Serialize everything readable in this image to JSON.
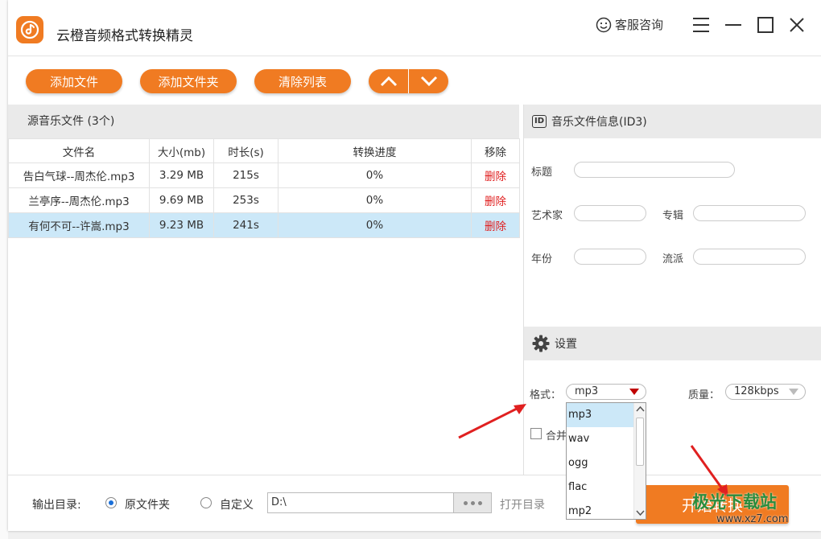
{
  "app": {
    "title": "云橙音频格式转换精灵",
    "customer_service": "客服咨询"
  },
  "toolbar": {
    "add_file": "添加文件",
    "add_folder": "添加文件夹",
    "clear_list": "清除列表"
  },
  "file_list": {
    "header": "源音乐文件 (3个)",
    "columns": [
      "文件名",
      "大小(mb)",
      "时长(s)",
      "转换进度",
      "移除"
    ],
    "rows": [
      {
        "name": "告白气球--周杰伦.mp3",
        "size": "3.29 MB",
        "duration": "215s",
        "progress": "0%",
        "remove": "删除",
        "selected": false
      },
      {
        "name": "兰亭序--周杰伦.mp3",
        "size": "9.69 MB",
        "duration": "253s",
        "progress": "0%",
        "remove": "删除",
        "selected": false
      },
      {
        "name": "有何不可--许嵩.mp3",
        "size": "9.23 MB",
        "duration": "241s",
        "progress": "0%",
        "remove": "删除",
        "selected": true
      }
    ]
  },
  "id3": {
    "header": "音乐文件信息(ID3)",
    "badge": "ID",
    "title_label": "标题",
    "artist_label": "艺术家",
    "album_label": "专辑",
    "year_label": "年份",
    "genre_label": "流派",
    "title_value": "",
    "artist_value": "",
    "album_value": "",
    "year_value": "",
    "genre_value": ""
  },
  "settings": {
    "header": "设置",
    "format_label": "格式：",
    "format_value": "mp3",
    "quality_label": "质量：",
    "quality_value": "128kbps",
    "merge_label": "合并",
    "format_options": [
      "mp3",
      "wav",
      "ogg",
      "flac",
      "mp2"
    ]
  },
  "output": {
    "label": "输出目录:",
    "option_original": "原文件夹",
    "option_custom": "自定义",
    "path": "D:\\",
    "open_dir": "打开目录",
    "start": "开始转换",
    "selected_option": "原文件夹"
  },
  "watermark": {
    "text": "极光下载站",
    "url": "www.xz7.com"
  },
  "colors": {
    "accent": "#f07b22",
    "selected_row": "#cce8f8",
    "delete_text": "#e02020",
    "annotation_arrow": "#e02020"
  }
}
